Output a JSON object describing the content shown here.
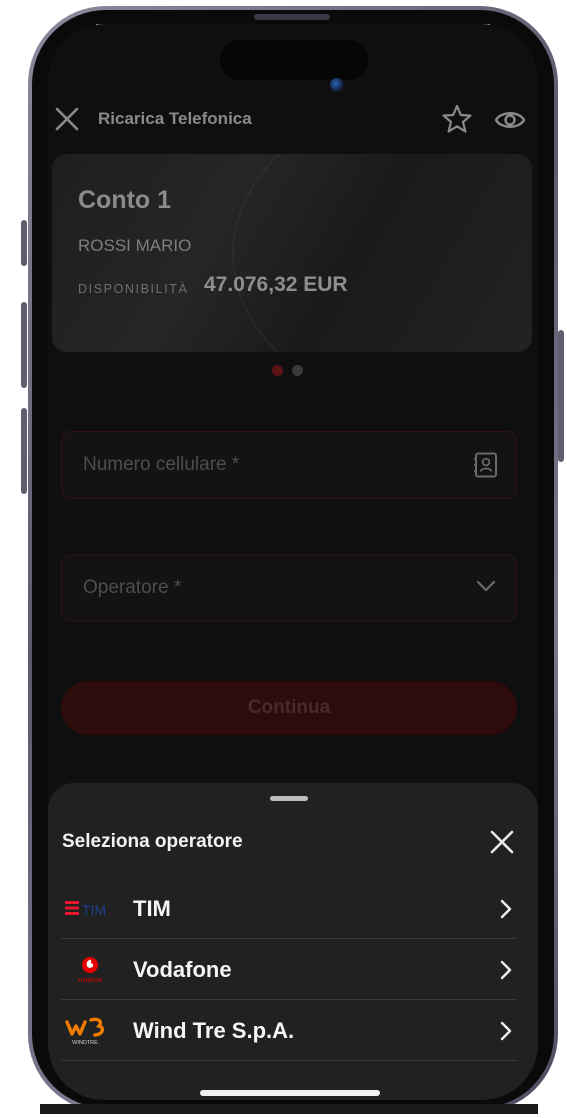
{
  "header": {
    "title": "Ricarica Telefonica",
    "close_icon": "close-icon",
    "favorite_icon": "star-icon",
    "visibility_icon": "eye-icon"
  },
  "account_card": {
    "name": "Conto 1",
    "holder": "ROSSI MARIO",
    "availability_label": "DISPONIBILITÀ",
    "availability_value": "47.076,32 EUR"
  },
  "carousel": {
    "pages": 2,
    "active_index": 0
  },
  "form": {
    "phone_placeholder": "Numero cellulare *",
    "operator_placeholder": "Operatore *",
    "continue_label": "Continua"
  },
  "sheet": {
    "title": "Seleziona operatore",
    "operators": [
      {
        "name": "TIM",
        "logo": "tim-logo"
      },
      {
        "name": "Vodafone",
        "logo": "vodafone-logo"
      },
      {
        "name": "Wind Tre S.p.A.",
        "logo": "windtre-logo"
      }
    ]
  },
  "logo_text": {
    "tim": "TIM",
    "vodafone": "vodafone",
    "windtre": "WINDTRE"
  },
  "colors": {
    "accent_red": "#e60000",
    "sheet_bg": "#212121",
    "screen_bg": "#0f0f0f"
  }
}
